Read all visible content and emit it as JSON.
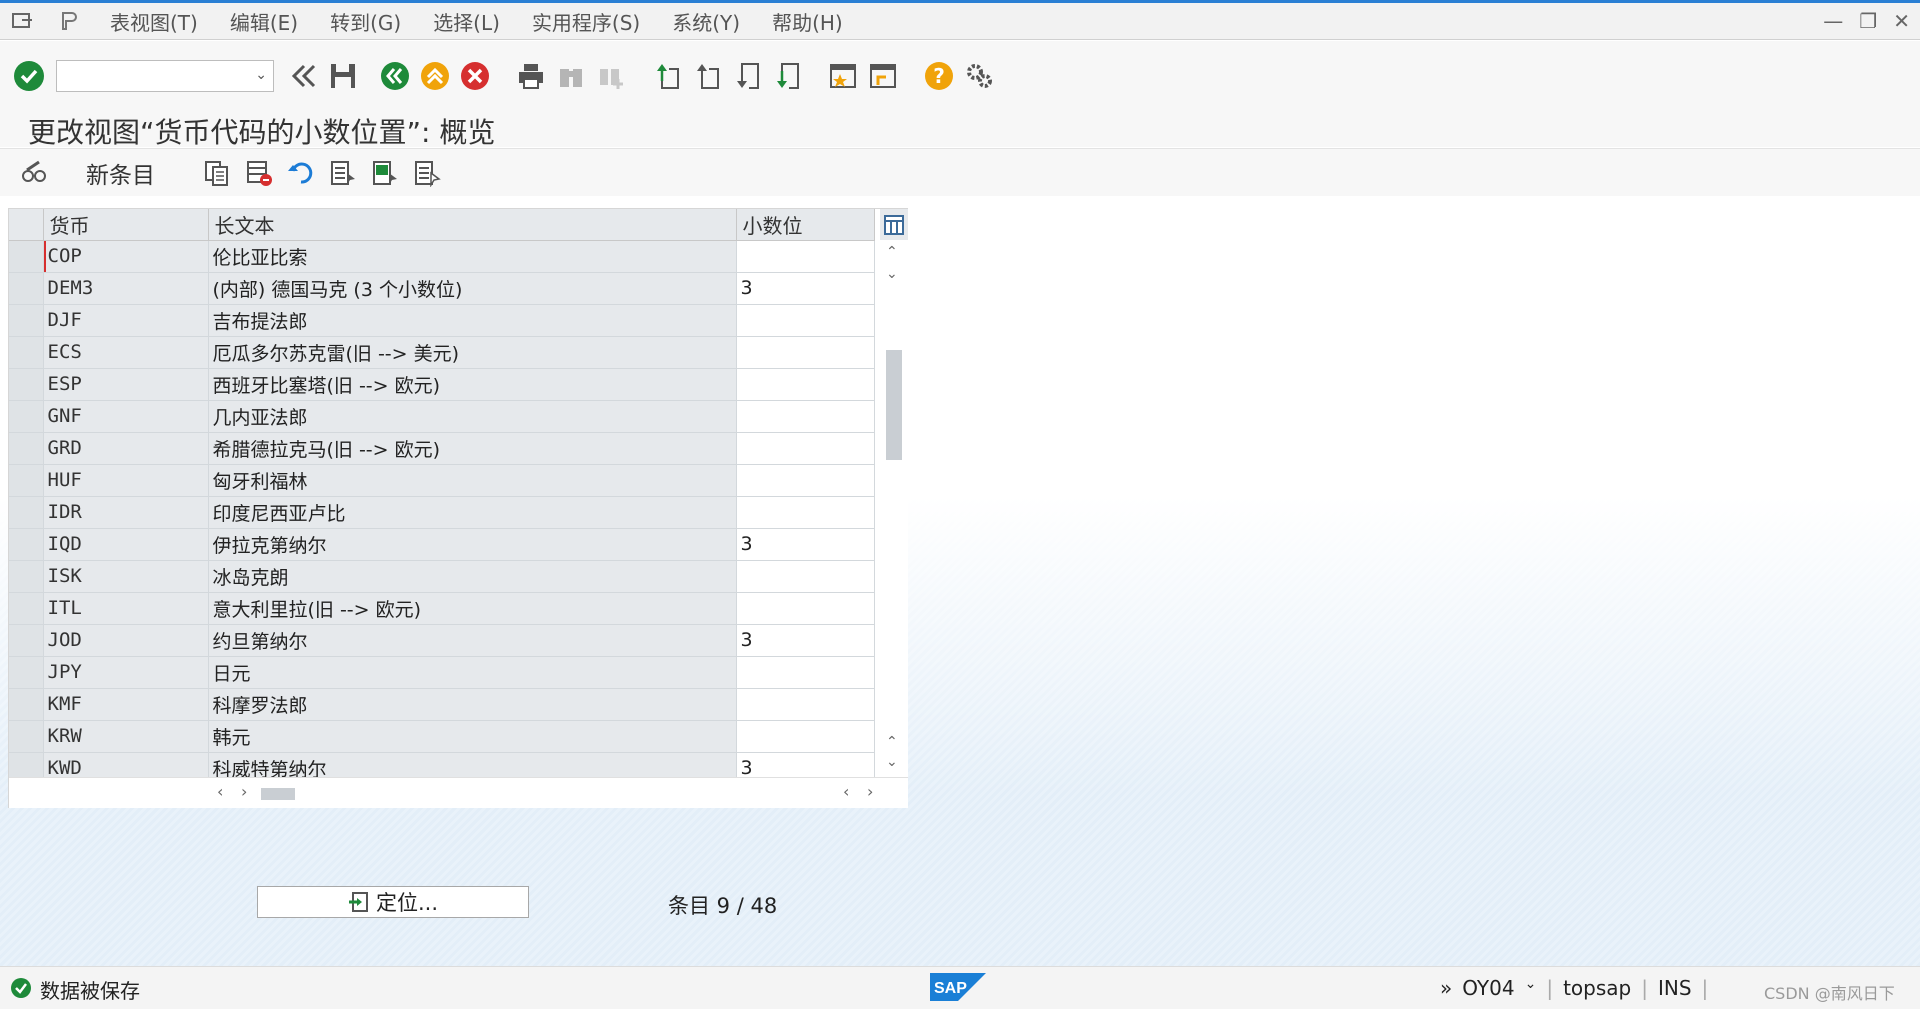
{
  "menubar": {
    "items": [
      "表视图(T)",
      "编辑(E)",
      "转到(G)",
      "选择(L)",
      "实用程序(S)",
      "系统(Y)",
      "帮助(H)"
    ]
  },
  "page_title": "更改视图“货币代码的小数位置”: 概览",
  "app_toolbar": {
    "new_entries": "新条目"
  },
  "table": {
    "headers": [
      "货币",
      "长文本",
      "小数位"
    ],
    "rows": [
      {
        "code": "COP",
        "text": "伦比亚比索",
        "dec": ""
      },
      {
        "code": "DEM3",
        "text": "(内部) 德国马克 (3 个小数位)",
        "dec": "3"
      },
      {
        "code": "DJF",
        "text": "吉布提法郎",
        "dec": ""
      },
      {
        "code": "ECS",
        "text": "厄瓜多尔苏克雷(旧 --> 美元)",
        "dec": ""
      },
      {
        "code": "ESP",
        "text": "西班牙比塞塔(旧 --> 欧元)",
        "dec": ""
      },
      {
        "code": "GNF",
        "text": "几内亚法郎",
        "dec": ""
      },
      {
        "code": "GRD",
        "text": "希腊德拉克马(旧 --> 欧元)",
        "dec": ""
      },
      {
        "code": "HUF",
        "text": "匈牙利福林",
        "dec": ""
      },
      {
        "code": "IDR",
        "text": "印度尼西亚卢比",
        "dec": ""
      },
      {
        "code": "IQD",
        "text": "伊拉克第纳尔",
        "dec": "3"
      },
      {
        "code": "ISK",
        "text": "冰岛克朗",
        "dec": ""
      },
      {
        "code": "ITL",
        "text": "意大利里拉(旧 --> 欧元)",
        "dec": ""
      },
      {
        "code": "JOD",
        "text": "约旦第纳尔",
        "dec": "3"
      },
      {
        "code": "JPY",
        "text": "日元",
        "dec": ""
      },
      {
        "code": "KMF",
        "text": "科摩罗法郎",
        "dec": ""
      },
      {
        "code": "KRW",
        "text": "韩元",
        "dec": ""
      },
      {
        "code": "KWD",
        "text": "科威特第纳尔",
        "dec": "3"
      }
    ]
  },
  "locate_button": "定位...",
  "entry_count": "条目 9 / 48",
  "status": {
    "message": "数据被保存",
    "transaction": "OY04",
    "user": "topsap",
    "mode": "INS",
    "watermark": "CSDN @南风日下"
  },
  "colors": {
    "accent": "#2a7fd4",
    "ok_green": "#1e8a3a",
    "cancel_red": "#d62f2f",
    "warn_orange": "#f0a30a"
  }
}
